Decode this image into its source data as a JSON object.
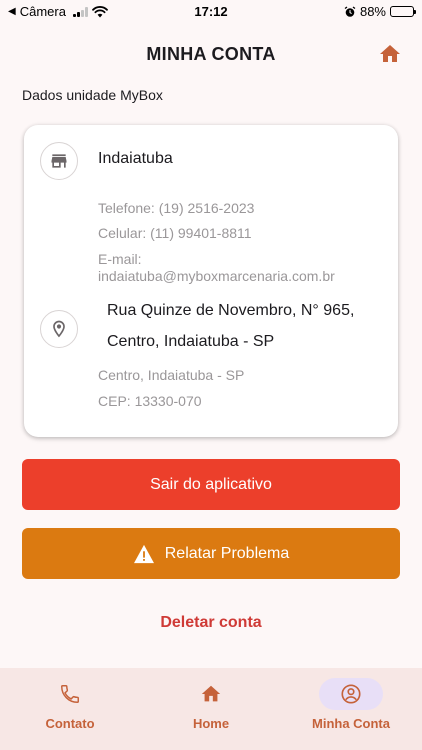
{
  "status_bar": {
    "carrier": "Câmera",
    "time": "17:12",
    "battery": "88%",
    "battery_level": 0.88
  },
  "header": {
    "title": "MINHA CONTA",
    "home_icon": "home-icon"
  },
  "section_label": "Dados unidade MyBox",
  "card": {
    "unit_name": "Indaiatuba",
    "phone": "Telefone: (19) 2516-2023",
    "mobile": "Celular: (11) 99401-8811",
    "email_label": "E-mail:",
    "email": "indaiatuba@myboxmarcenaria.com.br",
    "address_line1": "Rua Quinze de Novembro, N° 965,",
    "address_line2": "Centro, Indaiatuba - SP",
    "district": "Centro, Indaiatuba - SP",
    "cep": "CEP: 13330-070"
  },
  "buttons": {
    "logout": "Sair do aplicativo",
    "report": "Relatar Problema",
    "delete": "Deletar conta"
  },
  "nav": {
    "items": [
      {
        "label": "Contato",
        "icon": "phone-icon",
        "active": false
      },
      {
        "label": "Home",
        "icon": "home-icon",
        "active": false
      },
      {
        "label": "Minha Conta",
        "icon": "account-circle-icon",
        "active": true
      }
    ]
  },
  "colors": {
    "accent": "#c5623a",
    "logout": "#ec3f2b",
    "report": "#db7a11",
    "delete": "#cf3a36",
    "nav_bg": "#f7e7e5"
  }
}
